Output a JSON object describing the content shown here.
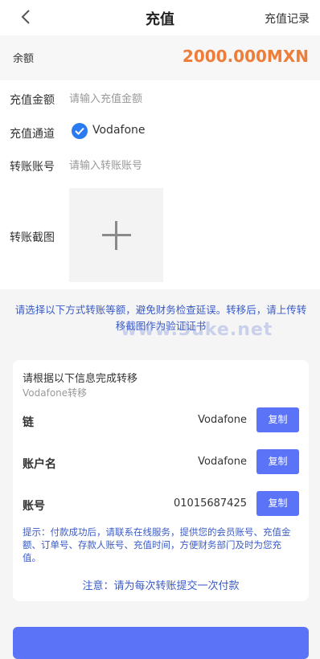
{
  "header": {
    "title": "充值",
    "records_label": "充值记录",
    "back_icon": "chevron-left-icon"
  },
  "balance": {
    "label": "余额",
    "value": "2000.000MXN",
    "color": "#ee7d3a"
  },
  "form": {
    "amount_label": "充值金额",
    "amount_placeholder": "请输入充值金额",
    "channel_label": "充值通道",
    "channel_selected": "Vodafone",
    "account_label": "转账账号",
    "account_placeholder": "请输入转账账号",
    "screenshot_label": "转账截图"
  },
  "notice": "请选择以下方式转账等额，避免财务检查延误。转移后，请上传转移截图作为验证证书",
  "watermark": "www.3uke.net",
  "info_card": {
    "title": "请根据以下信息完成转移",
    "subtitle": "Vodafone转移",
    "rows": [
      {
        "label": "链",
        "value": "Vodafone",
        "button": "复制"
      },
      {
        "label": "账户名",
        "value": "Vodafone",
        "button": "复制"
      },
      {
        "label": "账号",
        "value": "01015687425",
        "button": "复制"
      }
    ],
    "tip": "提示：付款成功后，请联系在线服务，提供您的会员账号、充值金额、订单号、存款人账号、充值时间，方便财务部门及时为您充值。",
    "note": "注意：请为每次转账提交一次付款"
  },
  "accent_color": "#5b73f6"
}
